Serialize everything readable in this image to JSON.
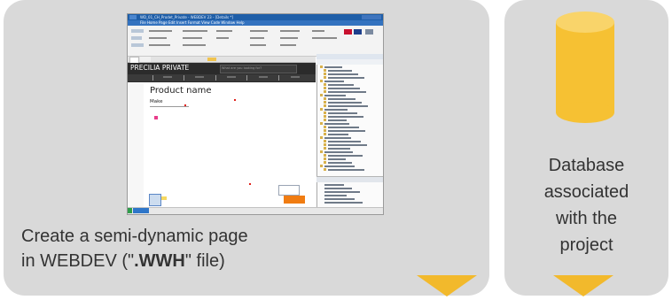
{
  "left_panel": {
    "caption_line1": "Create a semi-dynamic page",
    "caption_pre": "in WEBDEV (\"",
    "caption_bold": ".WWH",
    "caption_post": "\" file)"
  },
  "right_panel": {
    "caption_lines": [
      "Database",
      "associated",
      "with the",
      "project"
    ]
  },
  "screenshot": {
    "title": "WD_01_CH_Prodet_Private - WEBDEV 23 - [Details *]",
    "menu": "File  Home  Page  Edit  Insert  Format  View  Code  Window  Help",
    "brand": "PRECILIA PRIVATE",
    "search_placeholder": "What are you looking for?",
    "product_name": "Product name",
    "make_label": "Make"
  },
  "colors": {
    "card_background": "#d9d9d9",
    "accent_yellow": "#f2b92c",
    "database_cylinder": "#f6c133",
    "text": "#333333"
  },
  "icons": {
    "database": "database-cylinder-icon",
    "arrow": "triangle-down-icon"
  }
}
